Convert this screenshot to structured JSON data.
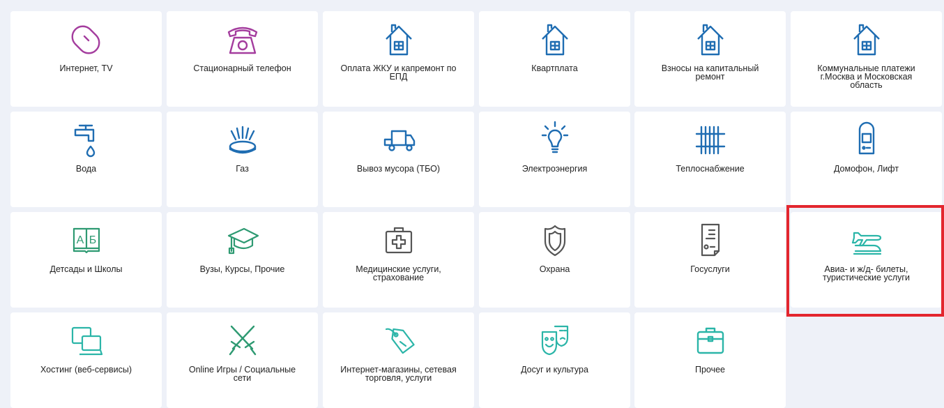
{
  "tiles": [
    {
      "label": "Интернет, TV",
      "icon": "mouse-icon"
    },
    {
      "label": "Стационарный телефон",
      "icon": "telephone-icon"
    },
    {
      "label": "Оплата ЖКУ и капремонт по\nЕПД",
      "icon": "house-icon"
    },
    {
      "label": "Квартплата",
      "icon": "house-icon"
    },
    {
      "label": "Взносы на капитальный\nремонт",
      "icon": "house-icon"
    },
    {
      "label": "Коммунальные платежи\nг.Москва и Московская\nобласть",
      "icon": "house-icon"
    },
    {
      "label": "Вода",
      "icon": "faucet-icon"
    },
    {
      "label": "Газ",
      "icon": "gas-burner-icon"
    },
    {
      "label": "Вывоз мусора (ТБО)",
      "icon": "truck-icon"
    },
    {
      "label": "Электроэнергия",
      "icon": "lightbulb-icon"
    },
    {
      "label": "Теплоснабжение",
      "icon": "radiator-icon"
    },
    {
      "label": "Домофон, Лифт",
      "icon": "intercom-icon"
    },
    {
      "label": "Детсады и Школы",
      "icon": "alphabet-book-icon",
      "icon_text": [
        "А",
        "Б"
      ]
    },
    {
      "label": "Вузы, Курсы, Прочие",
      "icon": "graduation-cap-icon"
    },
    {
      "label": "Медицинские услуги,\nстрахование",
      "icon": "first-aid-kit-icon"
    },
    {
      "label": "Охрана",
      "icon": "shield-icon"
    },
    {
      "label": "Госуслуги",
      "icon": "document-icon"
    },
    {
      "label": "Авиа- и ж/д- билеты,\nтуристические услуги",
      "icon": "plane-train-icon",
      "highlighted": true
    },
    {
      "label": "Хостинг (веб-сервисы)",
      "icon": "monitors-icon"
    },
    {
      "label": "Online Игры / Социальные\nсети",
      "icon": "crossed-swords-icon"
    },
    {
      "label": "Интернет-магазины, сетевая\nторговля, услуги",
      "icon": "price-tag-icon"
    },
    {
      "label": "Досуг и культура",
      "icon": "theater-masks-icon"
    },
    {
      "label": "Прочее",
      "icon": "briefcase-icon"
    }
  ],
  "colors": {
    "background": "#eef1f8",
    "tile": "#ffffff",
    "blue": "#1f6db2",
    "purple": "#a43d9e",
    "green": "#2e9a72",
    "teal": "#2bb5a8",
    "highlight": "#e3262e"
  }
}
